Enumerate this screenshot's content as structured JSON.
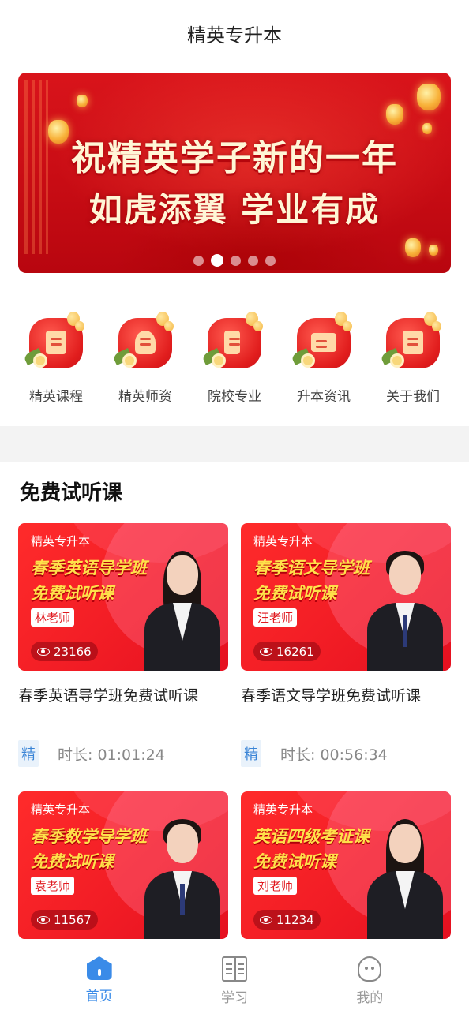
{
  "header": {
    "title": "精英专升本"
  },
  "banner": {
    "line1": "祝精英学子新的一年",
    "line2": "如虎添翼 学业有成",
    "dot_count": 5,
    "active_index": 1
  },
  "nav": [
    {
      "label": "精英课程",
      "icon": "course-icon"
    },
    {
      "label": "精英师资",
      "icon": "teacher-icon"
    },
    {
      "label": "院校专业",
      "icon": "school-icon"
    },
    {
      "label": "升本资讯",
      "icon": "news-icon"
    },
    {
      "label": "关于我们",
      "icon": "about-icon"
    }
  ],
  "section": {
    "title": "免费试听课"
  },
  "cards": [
    {
      "brand": "精英专升本",
      "course": "春季英语导学班",
      "free": "免费试听课",
      "teacher": "林老师",
      "views": "23166",
      "title": "春季英语导学班免费试听课",
      "tag": "精",
      "duration": "时长: 01:01:24"
    },
    {
      "brand": "精英专升本",
      "course": "春季语文导学班",
      "free": "免费试听课",
      "teacher": "汪老师",
      "views": "16261",
      "title": "春季语文导学班免费试听课",
      "tag": "精",
      "duration": "时长: 00:56:34"
    },
    {
      "brand": "精英专升本",
      "course": "春季数学导学班",
      "free": "免费试听课",
      "teacher": "袁老师",
      "views": "11567"
    },
    {
      "brand": "精英专升本",
      "course": "英语四级考证课",
      "free": "免费试听课",
      "teacher": "刘老师",
      "views": "11234"
    }
  ],
  "tabbar": {
    "home": "首页",
    "study": "学习",
    "me": "我的"
  },
  "colors": {
    "accent": "#3a8be8",
    "brand_red": "#e11d1d",
    "tag_bg": "#e9f2fb"
  }
}
